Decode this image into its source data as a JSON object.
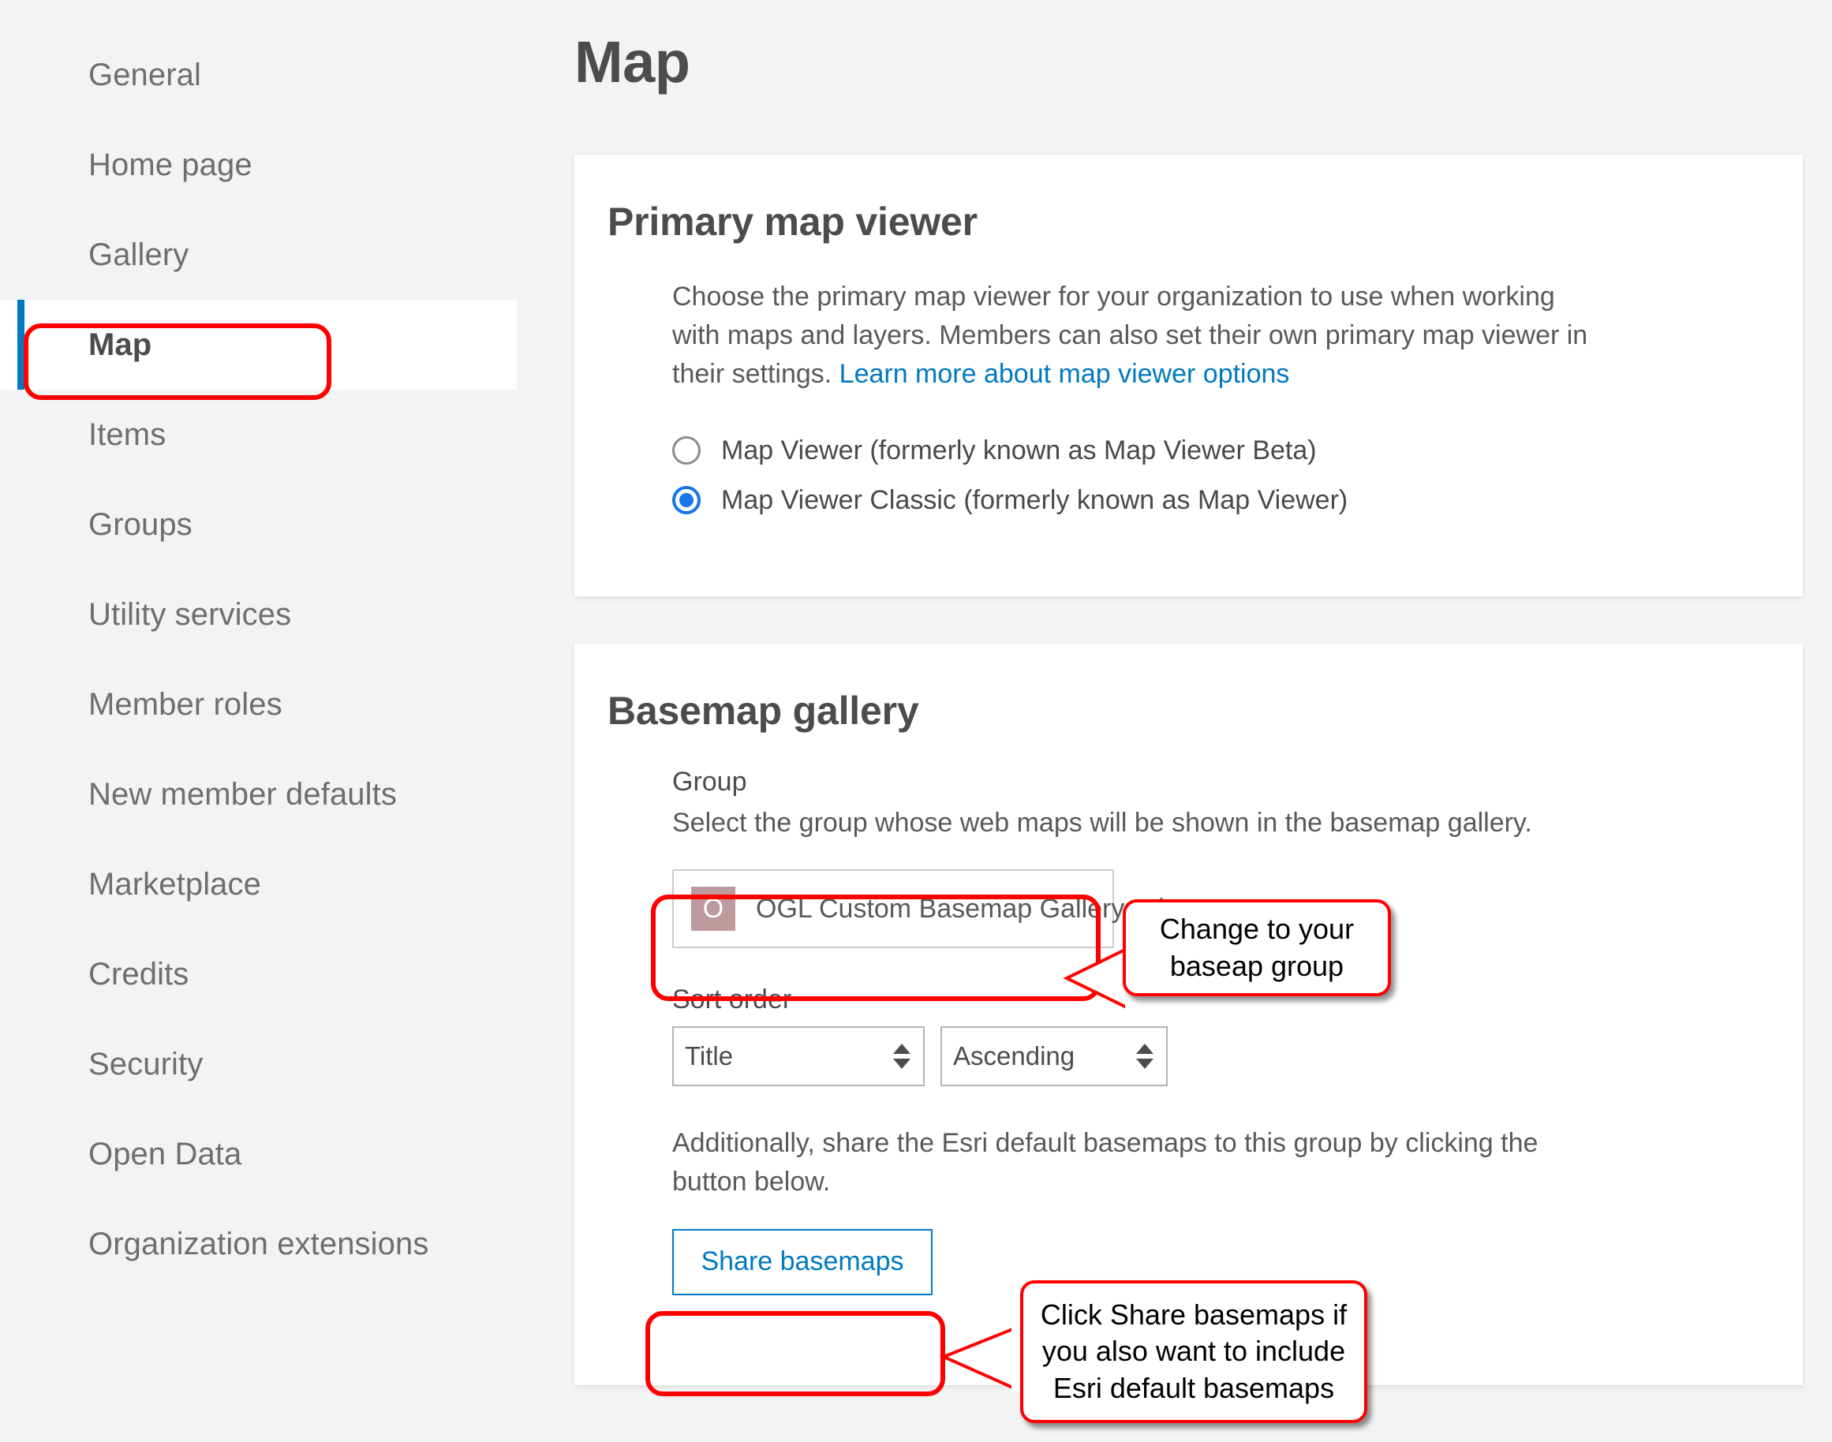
{
  "sidebar": {
    "items": [
      {
        "label": "General",
        "active": false
      },
      {
        "label": "Home page",
        "active": false
      },
      {
        "label": "Gallery",
        "active": false
      },
      {
        "label": "Map",
        "active": true
      },
      {
        "label": "Items",
        "active": false
      },
      {
        "label": "Groups",
        "active": false
      },
      {
        "label": "Utility services",
        "active": false
      },
      {
        "label": "Member roles",
        "active": false
      },
      {
        "label": "New member defaults",
        "active": false
      },
      {
        "label": "Marketplace",
        "active": false
      },
      {
        "label": "Credits",
        "active": false
      },
      {
        "label": "Security",
        "active": false
      },
      {
        "label": "Open Data",
        "active": false
      },
      {
        "label": "Organization extensions",
        "active": false
      }
    ]
  },
  "page": {
    "title": "Map"
  },
  "primary_map_viewer": {
    "heading": "Primary map viewer",
    "description_before_link": "Choose the primary map viewer for your organization to use when working with maps and layers. Members can also set their own primary map viewer in their settings. ",
    "link_text": "Learn more about map viewer options",
    "options": [
      {
        "label": "Map Viewer (formerly known as Map Viewer Beta)",
        "selected": false
      },
      {
        "label": "Map Viewer Classic (formerly known as Map Viewer)",
        "selected": true
      }
    ]
  },
  "basemap_gallery": {
    "heading": "Basemap gallery",
    "group_label": "Group",
    "group_description": "Select the group whose web maps will be shown in the basemap gallery.",
    "group_value": "OGL Custom Basemap Gallery",
    "group_thumb_letter": "O",
    "group_thumb_color": "#bd9a9e",
    "edit_icon": "pencil-icon",
    "sort_order_label": "Sort order",
    "sort_field_value": "Title",
    "sort_direction_value": "Ascending",
    "share_note": "Additionally, share the Esri default basemaps to this group by clicking the button below.",
    "share_button_label": "Share basemaps"
  },
  "annotations": {
    "accent_color": "#ff0000",
    "callout_group": "Change to your\nbaseap group",
    "callout_group_line1": "Change to your",
    "callout_group_line2": "baseap group",
    "callout_share_line1": "Click Share basemaps if",
    "callout_share_line2": "you also want to include",
    "callout_share_line3": "Esri default basemaps"
  },
  "colors": {
    "page_background": "#f3f3f3",
    "card_background": "#ffffff",
    "active_bar": "#0079c1",
    "link": "#0079c1",
    "radio_selected": "#1976e8",
    "text_muted": "#6e6e6e"
  }
}
